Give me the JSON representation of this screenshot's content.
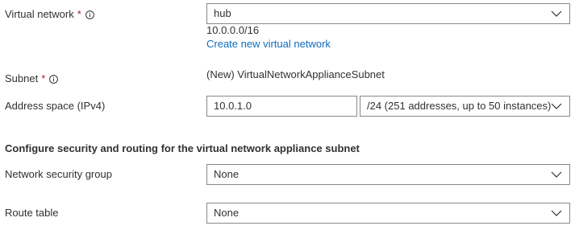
{
  "vnet": {
    "label": "Virtual network",
    "required": "*",
    "value": "hub",
    "address": "10.0.0.0/16",
    "create_link": "Create new virtual network"
  },
  "subnet": {
    "label": "Subnet",
    "required": "*",
    "value": "(New) VirtualNetworkApplianceSubnet"
  },
  "address_space": {
    "label": "Address space (IPv4)",
    "ip": "10.0.1.0",
    "prefix": "/24 (251 addresses, up to 50 instances)"
  },
  "security_section": {
    "title": "Configure security and routing for the virtual network appliance subnet"
  },
  "nsg": {
    "label": "Network security group",
    "value": "None"
  },
  "route_table": {
    "label": "Route table",
    "value": "None"
  },
  "icons": {
    "info": "info-icon",
    "dropdown": "chevron-down-icon"
  },
  "colors": {
    "required": "#a4262c",
    "link": "#0f6cbd",
    "border": "#8a8886"
  }
}
